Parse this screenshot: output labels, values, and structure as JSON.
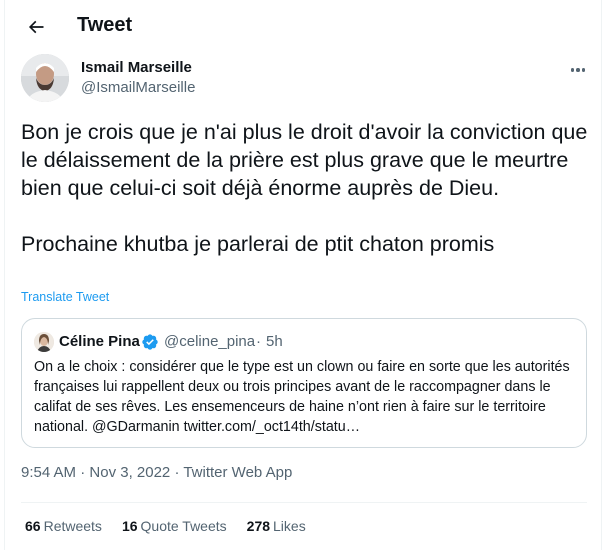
{
  "header": {
    "title": "Tweet"
  },
  "author": {
    "name": "Ismail Marseille",
    "handle": "@IsmailMarseille"
  },
  "tweet": {
    "paragraph1": "Bon je crois que je n'ai plus le droit d'avoir la conviction que le délaissement de la prière est plus grave que le meurtre bien que celui-ci soit déjà énorme auprès de Dieu.",
    "paragraph2": "Prochaine khutba je parlerai de ptit chaton promis",
    "translate_label": "Translate Tweet"
  },
  "quote": {
    "name": "Céline Pina",
    "handle": "@celine_pina",
    "separator": "·",
    "time": "5h",
    "text": "On a le choix : considérer que le type est un clown ou faire en sorte que les autorités françaises lui rappellent deux ou trois principes avant de le raccompagner dans le califat de ses rêves. Les ensemenceurs de haine n’ont rien à faire sur le territoire national. @GDarmanin twitter.com/_oct14th/statu…"
  },
  "meta": {
    "time": "9:54 AM",
    "sep1": " · ",
    "date": "Nov 3, 2022",
    "sep2": " · ",
    "source": "Twitter Web App"
  },
  "stats": {
    "retweets_count": "66",
    "retweets_label": "Retweets",
    "quotes_count": "16",
    "quotes_label": "Quote Tweets",
    "likes_count": "278",
    "likes_label": "Likes"
  },
  "icons": {
    "back": "arrow-left-icon",
    "more": "more-horizontal-icon",
    "verified": "verified-badge-icon"
  },
  "colors": {
    "accent": "#1d9bf0",
    "text_primary": "#0f1419",
    "text_secondary": "#536471",
    "border": "#cfd9de"
  }
}
